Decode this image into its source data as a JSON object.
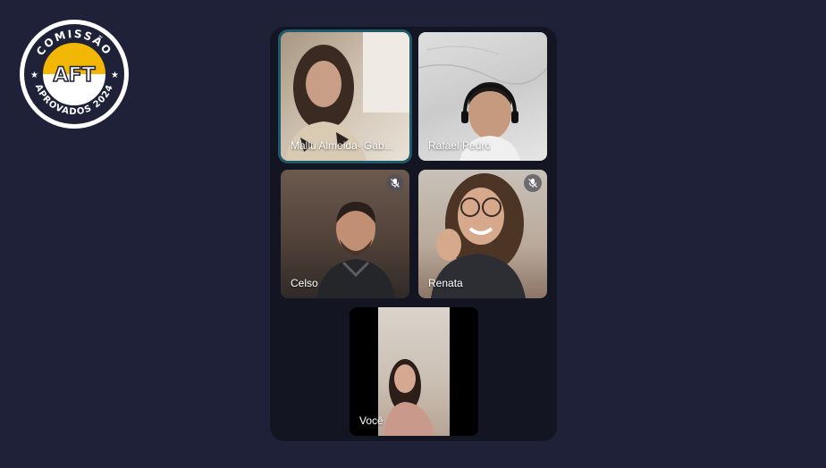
{
  "logo": {
    "top_text": "COMISSÃO",
    "center_text": "AFT",
    "bottom_text": "APROVADOS 2024",
    "colors": {
      "ring": "#1f2139",
      "accent": "#f2b705",
      "inner": "#ffffff"
    }
  },
  "call": {
    "participants": [
      {
        "name": "Mallu Almeida- Gab...",
        "active_speaker": true,
        "muted": false,
        "icon": "person-icon"
      },
      {
        "name": "Rafael Pedro",
        "active_speaker": false,
        "muted": false,
        "icon": "person-icon"
      },
      {
        "name": "Celso",
        "active_speaker": false,
        "muted": true,
        "icon": "mic-off-icon"
      },
      {
        "name": "Renata",
        "active_speaker": false,
        "muted": true,
        "icon": "mic-off-icon"
      },
      {
        "name": "Você",
        "active_speaker": false,
        "muted": false,
        "icon": "person-icon"
      }
    ]
  },
  "theme": {
    "background": "#1f2139",
    "panel": "#131622",
    "active_border": "#1f5a6a"
  }
}
